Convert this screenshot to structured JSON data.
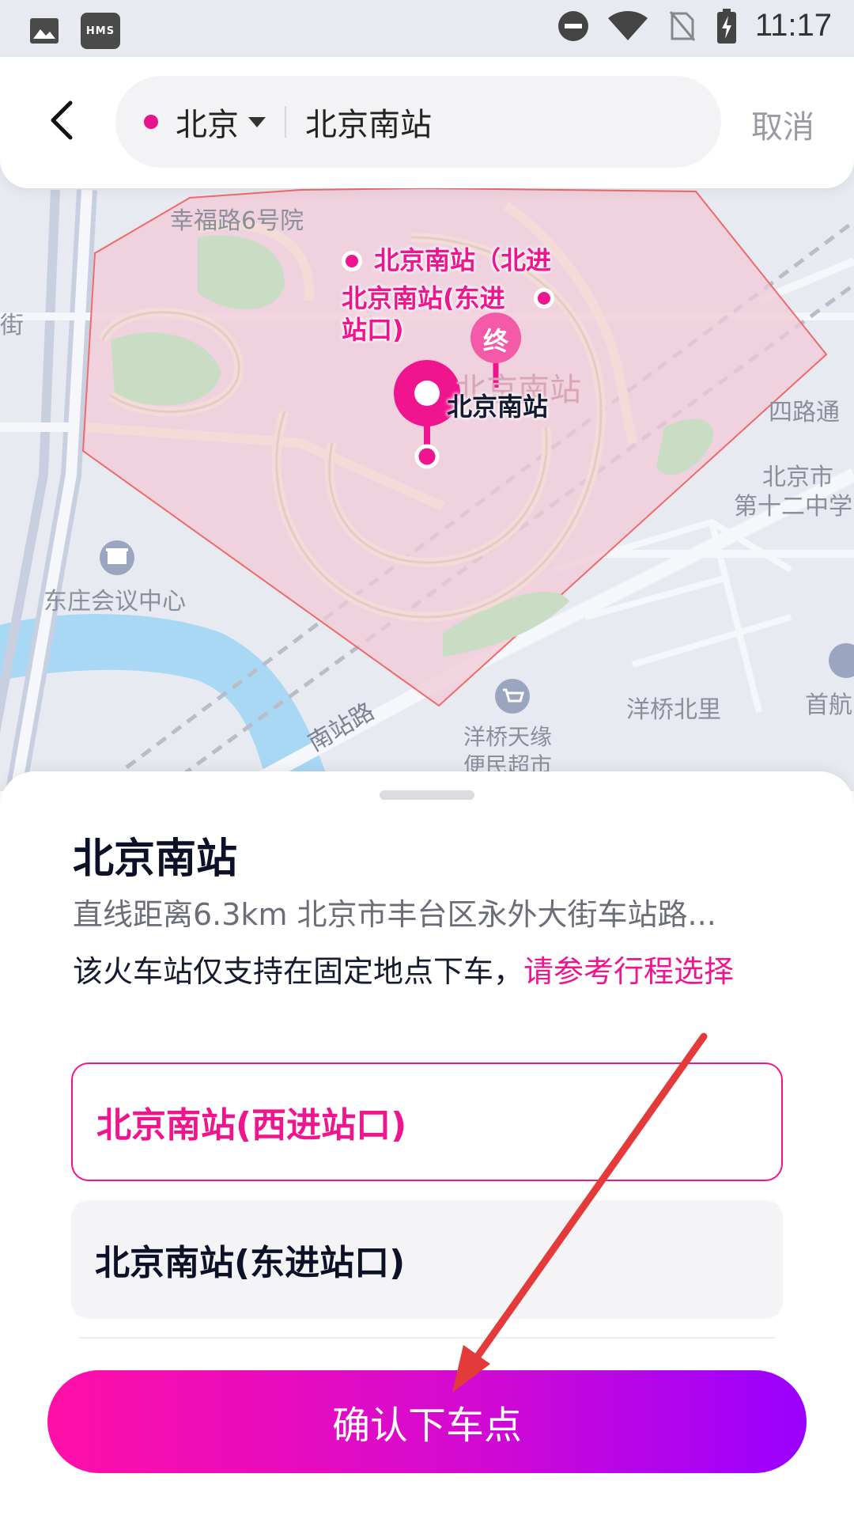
{
  "status_bar": {
    "hms_label": "HMS",
    "time": "11:17",
    "icons": [
      "image-icon",
      "hms-icon",
      "dnd-icon",
      "wifi-icon",
      "no-sim-icon",
      "battery-charging-icon"
    ]
  },
  "header": {
    "back_icon": "chevron-left-icon",
    "city": "北京",
    "search_value": "北京南站",
    "cancel_label": "取消"
  },
  "map": {
    "labels": {
      "xingfu_road": "幸福路6号院",
      "jie": "街",
      "dongzhuang": "东庄会议中心",
      "silutong": "四路通",
      "beijing_city": "北京市",
      "no12": "第十二中学",
      "yangqiao_north": "洋桥北里",
      "tianyuan_1": "洋桥天缘",
      "tianyuan_2": "便民超市",
      "nanzhan_road": "南站路",
      "shouhang": "首航",
      "area_watermark": "北京南站"
    },
    "pins": {
      "north_entrance": "北京南站（北进",
      "east_entrance_1": "北京南站(东进",
      "east_entrance_2": "站口)",
      "end_badge": "终",
      "main": "北京南站"
    },
    "colors": {
      "area_fill": "#f2c9d7",
      "area_stroke": "#ef6b6b",
      "accent": "#f0148f",
      "water": "#a9d8f5"
    }
  },
  "sheet": {
    "title": "北京南站",
    "info": "直线距离6.3km  北京市丰台区永外大街车站路...",
    "notice_text": "该火车站仅支持在固定地点下车，",
    "notice_link": "请参考行程选择",
    "options": [
      {
        "label": "北京南站(西进站口)",
        "selected": true
      },
      {
        "label": "北京南站(东进站口)",
        "selected": false
      }
    ],
    "confirm_label": "确认下车点"
  }
}
